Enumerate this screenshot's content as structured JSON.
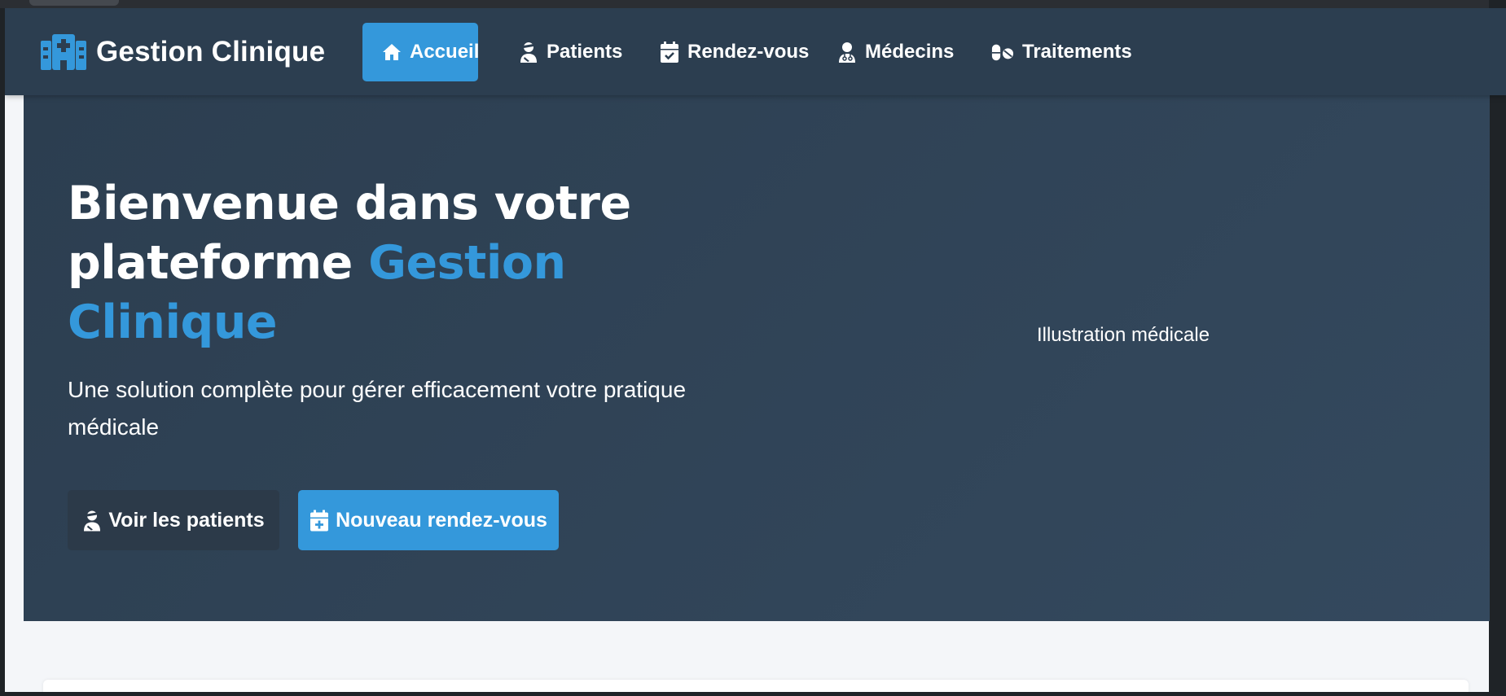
{
  "navbar": {
    "brand": {
      "label": "Gestion Clinique",
      "icon": "hospital-icon"
    },
    "items": [
      {
        "label": "Accueil",
        "icon": "home-icon",
        "active": true
      },
      {
        "label": "Patients",
        "icon": "user-injured-icon",
        "active": false
      },
      {
        "label": "Rendez-vous",
        "icon": "calendar-check-icon",
        "active": false
      },
      {
        "label": "Médecins",
        "icon": "user-doctor-icon",
        "active": false
      },
      {
        "label": "Traitements",
        "icon": "pills-icon",
        "active": false
      }
    ]
  },
  "hero": {
    "title_prefix": "Bienvenue dans votre plateforme",
    "title_accent": "Gestion Clinique",
    "subtitle": "Une solution complète pour gérer efficacement votre pratique médicale",
    "buttons": [
      {
        "label": "Voir les patients",
        "icon": "user-injured-icon"
      },
      {
        "label": "Nouveau rendez-vous",
        "icon": "calendar-plus-icon"
      }
    ],
    "illustration_alt": "Illustration médicale"
  },
  "colors": {
    "navbar_bg": "#2c3e50",
    "accent": "#3498db",
    "hero_bg": "#2e4258",
    "page_bg": "#f4f6f9"
  }
}
